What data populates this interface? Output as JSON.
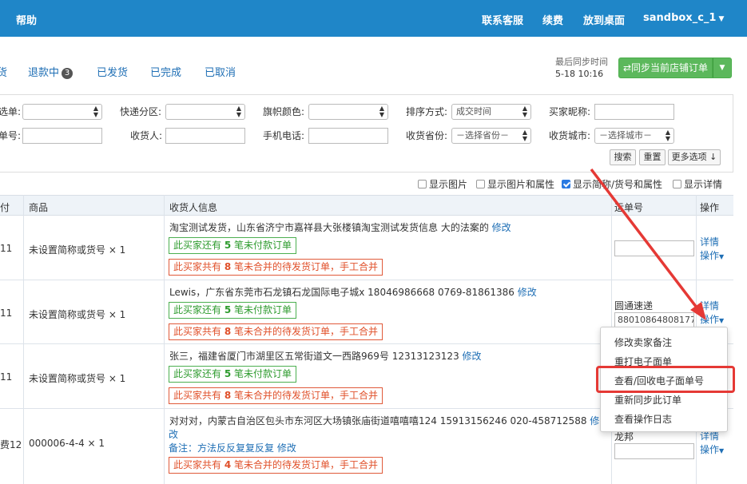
{
  "topbar": {
    "help": "帮助",
    "links": [
      "联系客服",
      "续费",
      "放到桌面"
    ],
    "user": "sandbox_c_1"
  },
  "tabs": {
    "partial_first": "货",
    "refunding": "退款中",
    "refunding_count": "3",
    "shipped": "已发货",
    "completed": "已完成",
    "cancelled": "已取消"
  },
  "sync": {
    "label": "最后同步时间",
    "time": "5-18 10:16",
    "button": "⇄同步当前店铺订单"
  },
  "filters": {
    "row1": [
      {
        "label": "选单:",
        "value": ""
      },
      {
        "label": "快递分区:",
        "value": ""
      },
      {
        "label": "旗帜颜色:",
        "value": ""
      },
      {
        "label": "排序方式:",
        "value": "成交时间"
      },
      {
        "label": "买家昵称:",
        "value": ""
      }
    ],
    "row2": [
      {
        "label": "单号:",
        "value": ""
      },
      {
        "label": "收货人:",
        "value": ""
      },
      {
        "label": "手机电话:",
        "value": ""
      },
      {
        "label": "收货省份:",
        "value": "－选择省份－"
      },
      {
        "label": "收货城市:",
        "value": "－选择城市－"
      }
    ],
    "buttons": {
      "search": "搜索",
      "reset": "重置",
      "more": "更多选项 ↓"
    }
  },
  "display_options": [
    {
      "label": "显示图片",
      "checked": false
    },
    {
      "label": "显示图片和属性",
      "checked": false
    },
    {
      "label": "显示简称/货号和属性",
      "checked": true
    },
    {
      "label": "显示详情",
      "checked": false
    }
  ],
  "table": {
    "headers": [
      "付",
      "商品",
      "收货人信息",
      "运单号",
      "操作"
    ],
    "rows": [
      {
        "time": "11",
        "goods": "未设置简称或货号 × 1",
        "address": "淘宝测试发货，山东省济宁市嘉祥县大张楼镇淘宝测试发货信息 大的法案的",
        "edit": "修改",
        "green_pre": "此买家还有 ",
        "green_num": "5",
        "green_post": " 笔未付款订单",
        "red_pre": "此买家共有 ",
        "red_num": "8",
        "red_post": " 笔未合并的待发货订单，手工合并",
        "courier": "",
        "waybill": ""
      },
      {
        "time": "11",
        "goods": "未设置简称或货号 × 1",
        "address": "Lewis，广东省东莞市石龙镇石龙国际电子城x 18046986668 0769-81861386",
        "edit": "修改",
        "green_pre": "此买家还有 ",
        "green_num": "5",
        "green_post": " 笔未付款订单",
        "red_pre": "此买家共有 ",
        "red_num": "8",
        "red_post": " 笔未合并的待发货订单，手工合并",
        "courier": "圆通速递",
        "waybill": "880108648081774"
      },
      {
        "time": "11",
        "goods": "未设置简称或货号 × 1",
        "address": "张三，福建省厦门市湖里区五常街道文一西路969号 12313123123",
        "edit": "修改",
        "green_pre": "此买家还有 ",
        "green_num": "5",
        "green_post": " 笔未付款订单",
        "red_pre": "此买家共有 ",
        "red_num": "8",
        "red_post": " 笔未合并的待发货订单，手工合并",
        "courier": "",
        "waybill": ""
      },
      {
        "time": "费12",
        "goods": "000006-4-4 × 1",
        "address": "对对对，内蒙古自治区包头市东河区大场镇张庙街道嘻嘻嘻124 15913156246 020-458712588",
        "edit": "修",
        "edit2": "改",
        "note_label": "备注：方法反反复复反复",
        "note_edit": "修改",
        "red_pre": "此买家共有 ",
        "red_num": "4",
        "red_post": " 笔未合并的待发货订单，手工合并",
        "courier": "龙邦",
        "waybill": ""
      }
    ],
    "ops_detail": "详情",
    "ops_action": "操作"
  },
  "context_menu": [
    "修改卖家备注",
    "重打电子面单",
    "查看/回收电子面单号",
    "重新同步此订单",
    "查看操作日志"
  ],
  "colors": {
    "topbar": "#1f86c8",
    "link": "#1f6fb5",
    "sync_button": "#5cb85c",
    "highlight": "#e53935"
  }
}
